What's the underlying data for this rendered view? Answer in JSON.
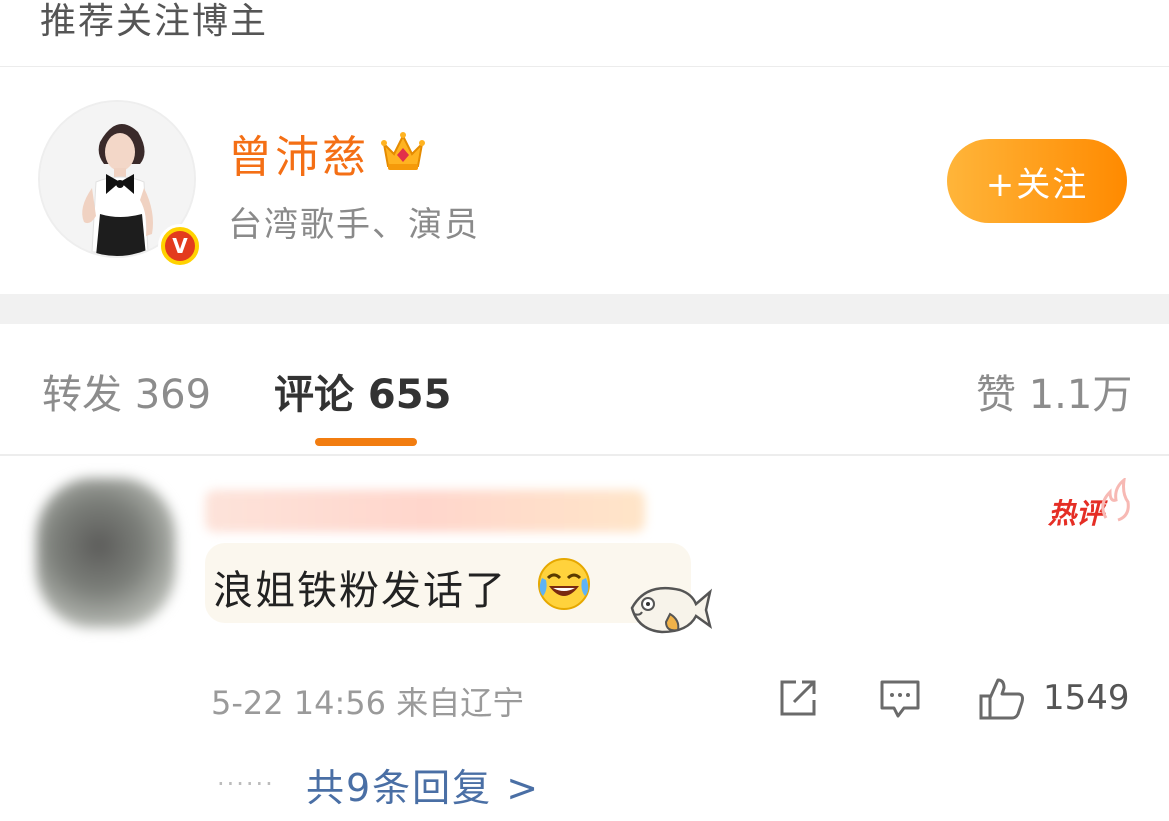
{
  "section": {
    "title": "推荐关注博主"
  },
  "blogger": {
    "name": "曾沛慈",
    "description": "台湾歌手、演员",
    "follow_label": "+关注",
    "verified_mark": "V"
  },
  "tabs": [
    {
      "label": "转发 369"
    },
    {
      "label": "评论 655"
    },
    {
      "label": "赞 1.1万"
    }
  ],
  "comment": {
    "badge": "热评",
    "text": "浪姐铁粉发话了",
    "meta": "5-22 14:56 来自辽宁",
    "like_count": "1549",
    "dots": "······",
    "replies_label": "共9条回复 >"
  },
  "colors": {
    "accent": "#f46f15",
    "follow_button": "#ff9a1f",
    "hot_badge": "#e52e25",
    "reply_link": "#4a6fa5"
  }
}
